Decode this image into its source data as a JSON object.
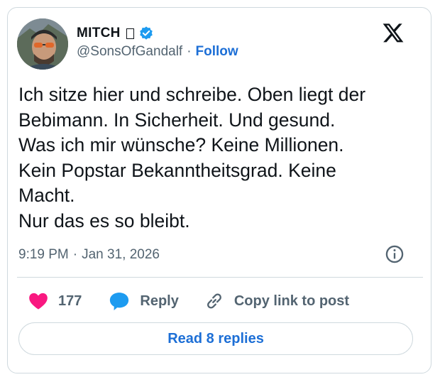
{
  "author": {
    "display_name": "MITCH",
    "handle": "@SonsOfGandalf",
    "follow_label": "Follow",
    "separator": "·"
  },
  "tweet": {
    "text": "Ich sitze hier und schreibe. Oben liegt der\nBebimann. In Sicherheit. Und gesund.\nWas ich mir wünsche? Keine Millionen.\nKein Popstar Bekanntheitsgrad. Keine\nMacht.\nNur das es so bleibt.",
    "time": "9:19 PM",
    "separator": "·",
    "date": "Jan 31, 2026"
  },
  "actions": {
    "like_count": "177",
    "reply_label": "Reply",
    "copy_link_label": "Copy link to post"
  },
  "read_replies_label": "Read 8 replies",
  "colors": {
    "accent": "#1d6fd6",
    "like": "#f91880",
    "reply_bubble": "#1d9bf0",
    "verified": "#1d9bf0",
    "muted": "#536471",
    "border": "#cfd9de"
  },
  "icons": [
    "verified-badge-icon",
    "x-logo-icon",
    "info-icon",
    "heart-icon",
    "reply-bubble-icon",
    "link-icon"
  ]
}
